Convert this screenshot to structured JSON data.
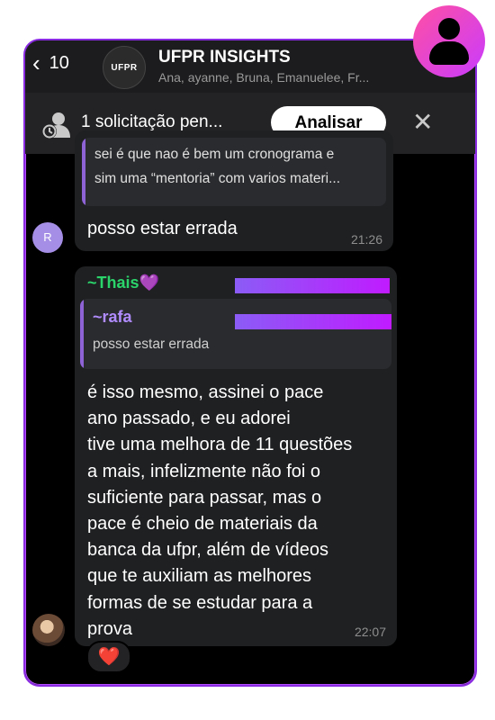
{
  "header": {
    "back_count": "10",
    "group_avatar_text": "UFPR",
    "title": "UFPR INSIGHTS",
    "subtitle": "Ana, ayanne, Bruna, Emanuelee, Fr..."
  },
  "request_bar": {
    "text": "1 solicitação pen...",
    "button_label": "Analisar",
    "close_symbol": "✕"
  },
  "messages": [
    {
      "quoted_lines": [
        "sei é que nao é bem um cronograma e",
        "sim uma “mentoria” com varios materi..."
      ],
      "text": "posso estar errada",
      "time": "21:26",
      "avatar_letter": "R"
    },
    {
      "sender": "~Thais",
      "sender_emoji": "💜",
      "quote_name": "~rafa",
      "quote_text": "posso estar errada",
      "lines": [
        "é isso mesmo, assinei o pace",
        "ano passado, e eu adorei",
        "tive uma melhora de 11 questões",
        "a mais, infelizmente não foi o",
        "suficiente para passar, mas o",
        "pace é cheio de materiais da",
        "banca da ufpr, além de vídeos",
        "que te auxiliam as melhores",
        "formas de se estudar para a",
        "prova"
      ],
      "time": "22:07",
      "reaction": "❤️"
    }
  ],
  "colors": {
    "accent_border": "#8a2be2",
    "sender_green": "#2bd46b",
    "quote_purple": "#b18cff",
    "redact_gradient_start": "#8b5cf6",
    "redact_gradient_end": "#c01bff"
  },
  "icons": {
    "back": "chevron-left-icon",
    "requests": "pending-request-icon",
    "close": "close-icon",
    "profile": "user-profile-icon"
  }
}
